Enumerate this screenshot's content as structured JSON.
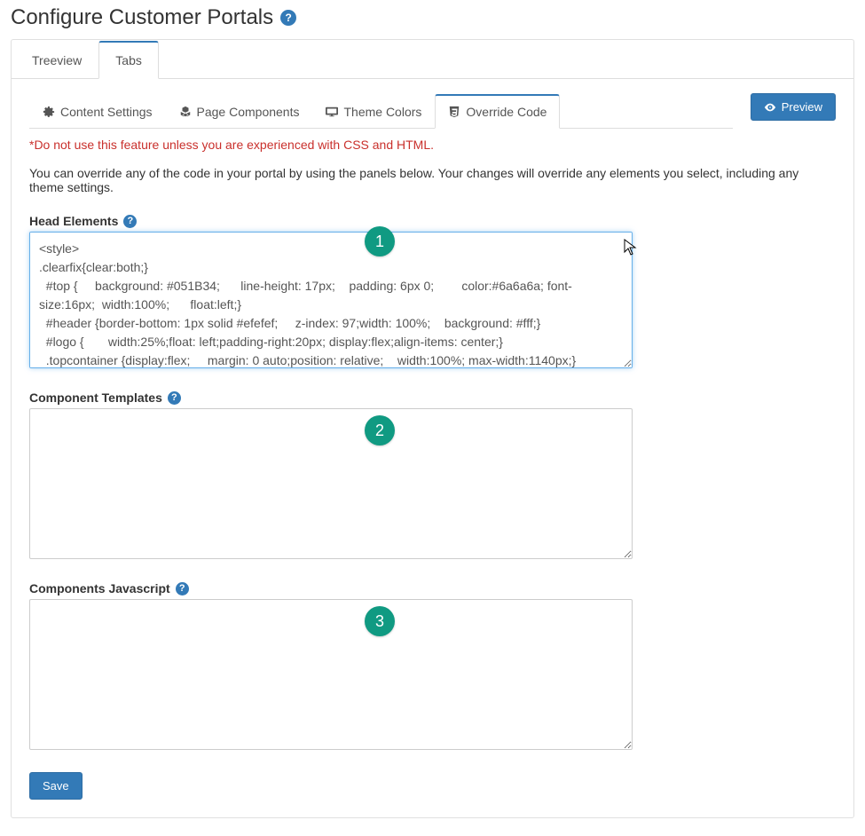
{
  "page": {
    "title": "Configure Customer Portals"
  },
  "viewTabs": {
    "treeview": "Treeview",
    "tabs": "Tabs"
  },
  "configTabs": {
    "content": "Content Settings",
    "components": "Page Components",
    "theme": "Theme Colors",
    "override": "Override Code"
  },
  "buttons": {
    "preview": "Preview",
    "save": "Save"
  },
  "warning": "*Do not use this feature unless you are experienced with CSS and HTML.",
  "description": "You can override any of the code in your portal by using the panels below. Your changes will override any elements you select, including any theme settings.",
  "fields": {
    "head": {
      "label": "Head Elements",
      "value": "<style>\n.clearfix{clear:both;}\n  #top {     background: #051B34;      line-height: 17px;    padding: 6px 0;        color:#6a6a6a; font-size:16px;  width:100%;      float:left;}\n  #header {border-bottom: 1px solid #efefef;     z-index: 97;width: 100%;    background: #fff;}\n  #logo {       width:25%;float: left;padding-right:20px; display:flex;align-items: center;}\n  .topcontainer {display:flex;     margin: 0 auto;position: relative;    width:100%; max-width:1140px;}"
    },
    "templates": {
      "label": "Component Templates",
      "value": ""
    },
    "javascript": {
      "label": "Components Javascript",
      "value": ""
    }
  },
  "annotations": {
    "one": "1",
    "two": "2",
    "three": "3"
  }
}
